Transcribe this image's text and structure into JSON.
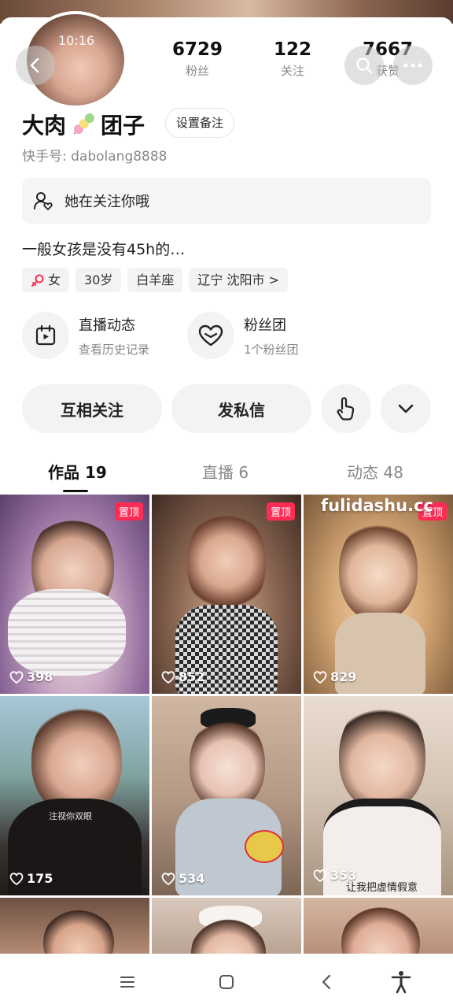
{
  "profile": {
    "status_time": "10:16",
    "name_part1": "大肉",
    "name_part2": "团子",
    "remark_button": "设置备注",
    "kuaishou_id": "快手号: dabolang8888",
    "follows_you": "她在关注你哦",
    "bio": "一般女孩是没有45h的…"
  },
  "stats": [
    {
      "value": "6729",
      "label": "粉丝"
    },
    {
      "value": "122",
      "label": "关注"
    },
    {
      "value": "7667",
      "label": "获赞"
    }
  ],
  "tags": {
    "gender": "女",
    "age": "30岁",
    "zodiac": "白羊座",
    "location": "辽宁 沈阳市 >"
  },
  "features": {
    "live": {
      "title": "直播动态",
      "subtitle": "查看历史记录"
    },
    "fans": {
      "title": "粉丝团",
      "subtitle": "1个粉丝团"
    }
  },
  "actions": {
    "mutual_follow": "互相关注",
    "message": "发私信"
  },
  "tabs": [
    {
      "label": "作品 19"
    },
    {
      "label": "直播 6"
    },
    {
      "label": "动态 48"
    }
  ],
  "watermark": "fulidashu.cc",
  "videos": [
    {
      "likes": "398",
      "pinned": "置顶",
      "caption": ""
    },
    {
      "likes": "852",
      "pinned": "置顶",
      "caption": ""
    },
    {
      "likes": "829",
      "pinned": "置顶",
      "caption": ""
    },
    {
      "likes": "175",
      "pinned": "",
      "caption": "注视你双眼"
    },
    {
      "likes": "534",
      "pinned": "",
      "caption": ""
    },
    {
      "likes": "353",
      "pinned": "",
      "caption": "让我把虚情假意"
    }
  ],
  "colors": {
    "accent": "#fe2c55",
    "muted": "#888888",
    "chip_bg": "#f3f3f3"
  }
}
